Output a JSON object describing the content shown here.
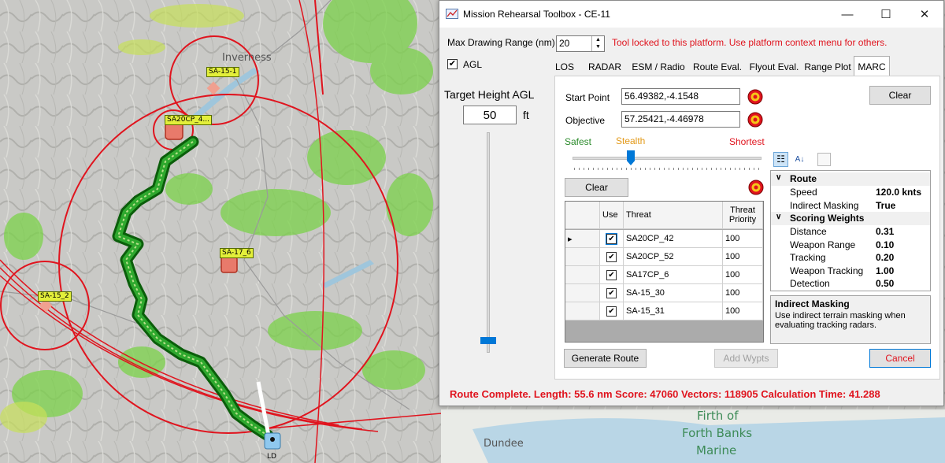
{
  "map": {
    "city_labels": [
      "Inverness",
      "Dundee"
    ],
    "coastal_labels": [
      "Firth of",
      "Forth Banks",
      "Marine"
    ],
    "threat_tags": [
      "SA-15-1",
      "SA20CP_4...",
      "SA-17_6",
      "SA-15_2"
    ],
    "launch_label": "LD",
    "colors": {
      "threat_ring": "#e0141e",
      "route": "#1c8a1c",
      "route_outline": "#0b5e0b"
    }
  },
  "window": {
    "title": "Mission Rehearsal Toolbox - CE-11",
    "max_range_label": "Max Drawing Range (nm)",
    "max_range_value": "20",
    "lock_message": "Tool locked to this platform. Use platform context menu for others.",
    "agl_label": "AGL",
    "agl_checked": true,
    "target_height_label": "Target Height AGL",
    "target_height_value": "50",
    "target_height_unit": "ft",
    "slider_level_fraction": 0.03,
    "tabs": [
      "LOS",
      "RADAR",
      "ESM / Radio",
      "Route Eval.",
      "Flyout Eval.",
      "Range Plot",
      "MARC"
    ],
    "active_tab": "MARC",
    "start_point_label": "Start Point",
    "start_point_value": "56.49382,-4.1548",
    "objective_label": "Objective",
    "objective_value": "57.25421,-4.46978",
    "clear_top_label": "Clear",
    "slider_labels": {
      "left": "Safest",
      "middle": "Stealth",
      "right": "Shortest"
    },
    "route_slider_fraction": 0.3,
    "clear_label": "Clear",
    "grid": {
      "headers": [
        "Use",
        "Threat",
        "Threat Priority"
      ],
      "rows": [
        {
          "use": true,
          "threat": "SA20CP_42",
          "priority": "100",
          "current": true
        },
        {
          "use": true,
          "threat": "SA20CP_52",
          "priority": "100",
          "current": false
        },
        {
          "use": true,
          "threat": "SA17CP_6",
          "priority": "100",
          "current": false
        },
        {
          "use": true,
          "threat": "SA-15_30",
          "priority": "100",
          "current": false
        },
        {
          "use": true,
          "threat": "SA-15_31",
          "priority": "100",
          "current": false
        }
      ]
    },
    "properties": {
      "categories": [
        {
          "name": "Route",
          "items": [
            {
              "name": "Speed",
              "value": "120.0 knts"
            },
            {
              "name": "Indirect Masking",
              "value": "True"
            }
          ]
        },
        {
          "name": "Scoring Weights",
          "items": [
            {
              "name": "Distance",
              "value": "0.31"
            },
            {
              "name": "Weapon Range",
              "value": "0.10"
            },
            {
              "name": "Tracking",
              "value": "0.20"
            },
            {
              "name": "Weapon Tracking",
              "value": "1.00"
            },
            {
              "name": "Detection",
              "value": "0.50"
            }
          ]
        }
      ],
      "description_title": "Indirect Masking",
      "description_text": "Use indirect terrain masking when evaluating tracking radars."
    },
    "generate_route_label": "Generate Route",
    "add_wypts_label": "Add Wypts",
    "cancel_label": "Cancel",
    "status_text": "Route Complete. Length: 55.6 nm  Score: 47060  Vectors: 118905  Calculation Time: 41.288",
    "accent_color": "#e0141e"
  }
}
